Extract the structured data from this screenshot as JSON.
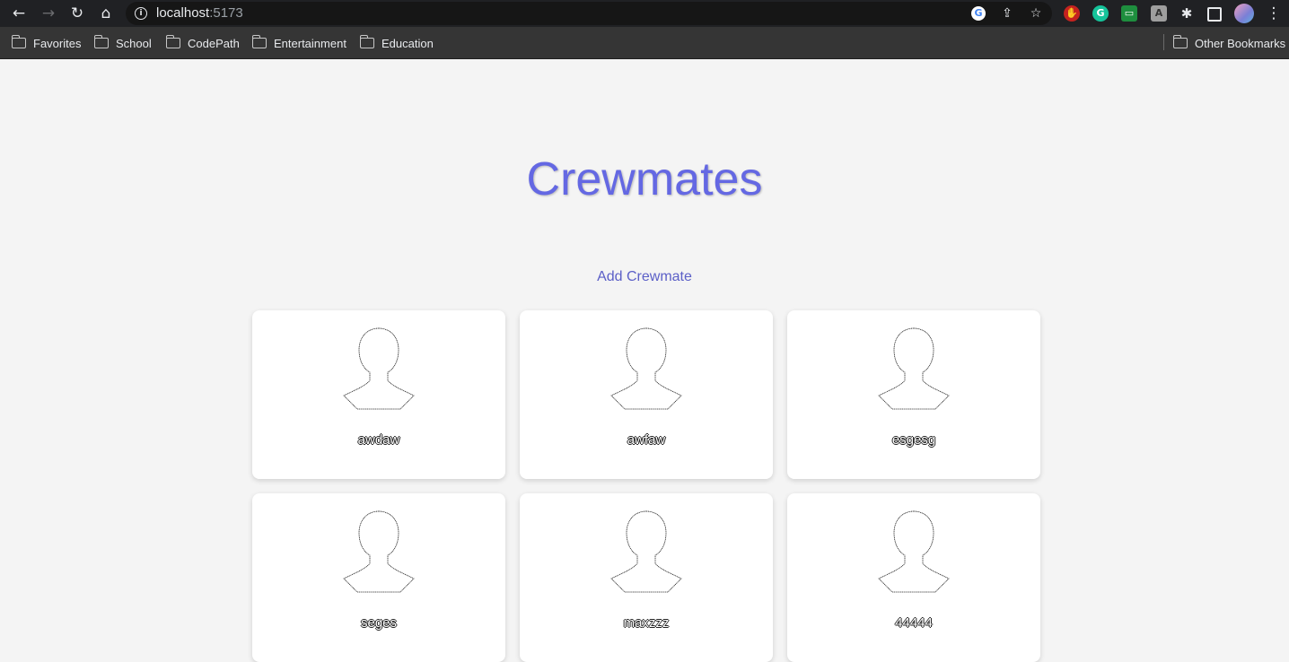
{
  "browser": {
    "url_host": "localhost",
    "url_port": ":5173",
    "bookmarks": [
      "Favorites",
      "School",
      "CodePath",
      "Entertainment",
      "Education"
    ],
    "other_bookmarks": "Other Bookmarks"
  },
  "page": {
    "title": "Crewmates",
    "add_link": "Add Crewmate"
  },
  "crewmates": [
    {
      "name": "awdaw"
    },
    {
      "name": "awfaw"
    },
    {
      "name": "esgesg"
    },
    {
      "name": "seges"
    },
    {
      "name": "maxzzz"
    },
    {
      "name": "44444"
    }
  ]
}
